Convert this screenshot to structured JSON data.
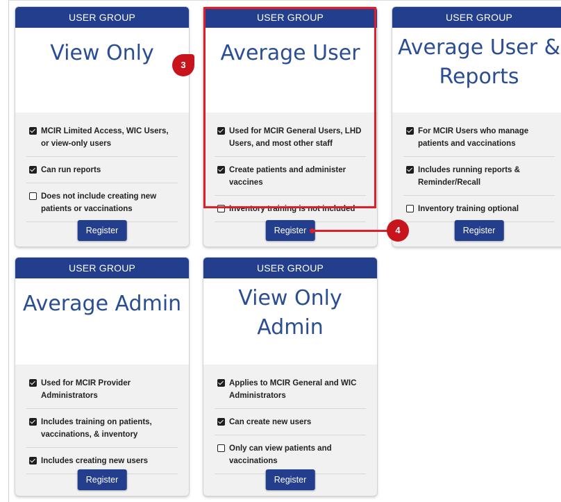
{
  "cards": [
    {
      "header": "USER GROUP",
      "title_lines": [
        "View Only"
      ],
      "features": [
        {
          "checked": true,
          "text": "MCIR Limited Access, WIC Users, or view-only users"
        },
        {
          "checked": true,
          "text": "Can run reports"
        },
        {
          "checked": false,
          "text": "Does not include creating new patients or vaccinations"
        }
      ],
      "button": "Register"
    },
    {
      "header": "USER GROUP",
      "title_lines": [
        "Average User"
      ],
      "features": [
        {
          "checked": true,
          "text": "Used for MCIR General Users, LHD Users, and most other staff"
        },
        {
          "checked": true,
          "text": "Create patients and administer vaccines"
        },
        {
          "checked": false,
          "text": "Inventory training is not included"
        }
      ],
      "button": "Register"
    },
    {
      "header": "USER GROUP",
      "title_lines": [
        "Average User &",
        "Reports"
      ],
      "features": [
        {
          "checked": true,
          "text": "For MCIR Users who manage patients and vaccinations"
        },
        {
          "checked": true,
          "text": "Includes running reports & Reminder/Recall"
        },
        {
          "checked": false,
          "text": "Inventory training optional"
        }
      ],
      "button": "Register"
    },
    {
      "header": "USER GROUP",
      "title_lines": [
        "Average Admin"
      ],
      "features": [
        {
          "checked": true,
          "text": "Used for MCIR Provider Administrators"
        },
        {
          "checked": true,
          "text": "Includes training on patients, vaccinations, & inventory"
        },
        {
          "checked": true,
          "text": "Includes creating new users"
        }
      ],
      "button": "Register"
    },
    {
      "header": "USER GROUP",
      "title_lines": [
        "View Only",
        "Admin"
      ],
      "features": [
        {
          "checked": true,
          "text": "Applies to MCIR General and WIC Administrators"
        },
        {
          "checked": true,
          "text": "Can create new users"
        },
        {
          "checked": false,
          "text": "Only can view patients and vaccinations"
        }
      ],
      "button": "Register"
    }
  ],
  "callouts": {
    "step3": "3",
    "step4": "4"
  },
  "colors": {
    "header": "#233e8c",
    "title": "#2a4d93",
    "highlight": "#de1f2b"
  }
}
